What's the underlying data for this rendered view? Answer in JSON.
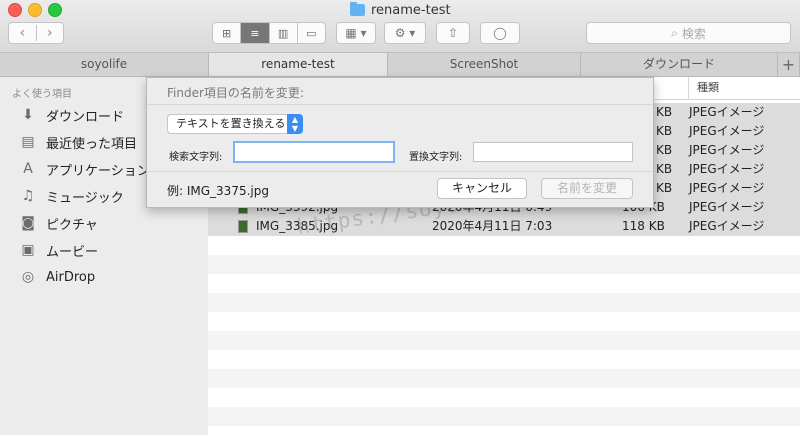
{
  "window": {
    "title": "rename-test"
  },
  "toolbar": {
    "search_placeholder": "検索",
    "back_glyph": "‹",
    "forward_glyph": "›",
    "view_glyphs": [
      "⊞",
      "≡",
      "▥",
      "▭"
    ],
    "arrange_glyph": "▦ ▾",
    "action_glyph": "⚙ ▾",
    "share_glyph": "⇧",
    "tag_glyph": "◯"
  },
  "tabs": [
    {
      "label": "soyolife"
    },
    {
      "label": "rename-test"
    },
    {
      "label": "ScreenShot"
    },
    {
      "label": "ダウンロード"
    }
  ],
  "tab_add": "+",
  "sidebar": {
    "section": "よく使う項目",
    "items": [
      {
        "label": "ダウンロード",
        "icon": "download-icon",
        "glyph": "⬇"
      },
      {
        "label": "最近使った項目",
        "icon": "recents-icon",
        "glyph": "▤"
      },
      {
        "label": "アプリケーション",
        "icon": "applications-icon",
        "glyph": "A"
      },
      {
        "label": "ミュージック",
        "icon": "music-icon",
        "glyph": "♫"
      },
      {
        "label": "ピクチャ",
        "icon": "pictures-icon",
        "glyph": "◙"
      },
      {
        "label": "ムービー",
        "icon": "movies-icon",
        "glyph": "▣"
      },
      {
        "label": "AirDrop",
        "icon": "airdrop-icon",
        "glyph": "◎"
      }
    ]
  },
  "list": {
    "kind_header": "種類",
    "rows": [
      {
        "name": "",
        "date": "",
        "size": "KB",
        "kind": "JPEGイメージ"
      },
      {
        "name": "",
        "date": "",
        "size": "KB",
        "kind": "JPEGイメージ"
      },
      {
        "name": "",
        "date": "",
        "size": "KB",
        "kind": "JPEGイメージ"
      },
      {
        "name": "",
        "date": "",
        "size": "KB",
        "kind": "JPEGイメージ"
      },
      {
        "name": "",
        "date": "",
        "size": "KB",
        "kind": "JPEGイメージ"
      },
      {
        "name": "IMG_3392.jpg",
        "date": "2020年4月11日 6:49",
        "size": "106 KB",
        "kind": "JPEGイメージ"
      },
      {
        "name": "IMG_3385.jpg",
        "date": "2020年4月11日 7:03",
        "size": "118 KB",
        "kind": "JPEGイメージ"
      }
    ]
  },
  "watermark": "https://soyo.life/",
  "dialog": {
    "title": "Finder項目の名前を変更:",
    "mode": "テキストを置き換える",
    "find_label": "検索文字列:",
    "find_value": "",
    "replace_label": "置換文字列:",
    "replace_value": "",
    "example": "例: IMG_3375.jpg",
    "cancel": "キャンセル",
    "rename": "名前を変更"
  }
}
